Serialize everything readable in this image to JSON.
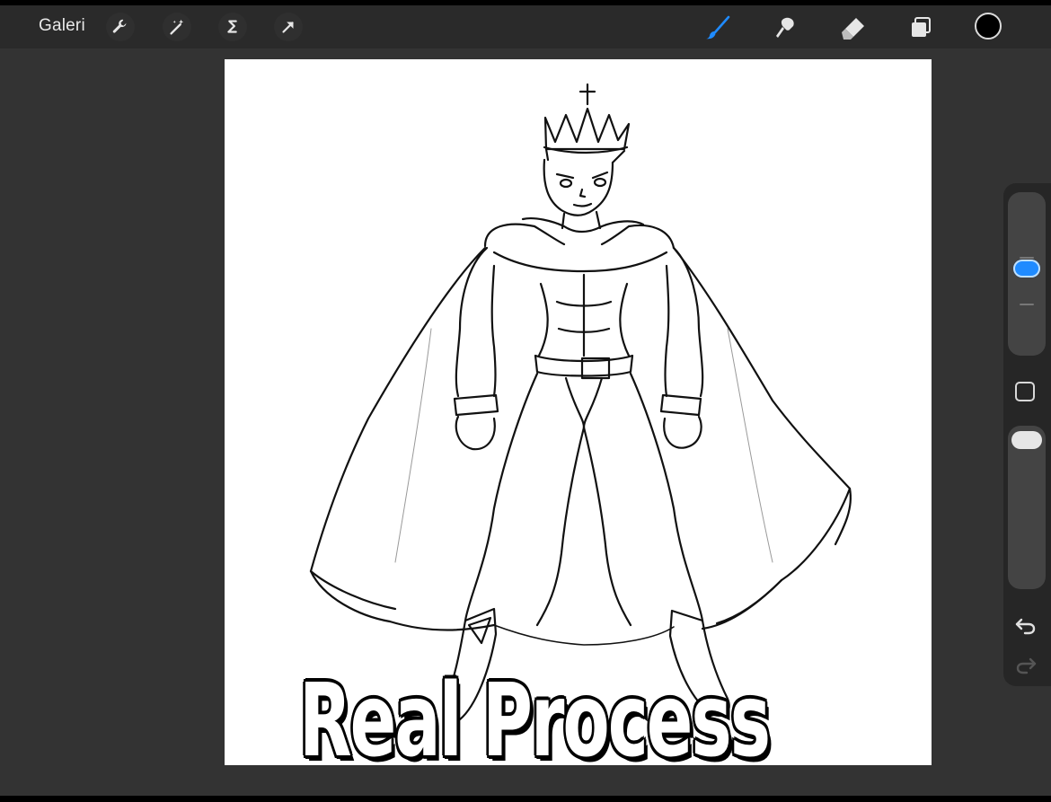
{
  "toolbar": {
    "gallery_label": "Galeri",
    "left_tools": [
      "wrench-icon",
      "magic-wand-icon",
      "selection-icon",
      "transform-arrow-icon"
    ],
    "right_tools": [
      "brush-icon",
      "smudge-icon",
      "eraser-icon",
      "layers-icon"
    ],
    "active_tool": "brush",
    "active_color": "#000000",
    "accent": "#1f8bff"
  },
  "sidebar": {
    "brush_size_level": 0.54,
    "opacity_level": 1.0
  },
  "caption": {
    "text": "Real Process"
  }
}
